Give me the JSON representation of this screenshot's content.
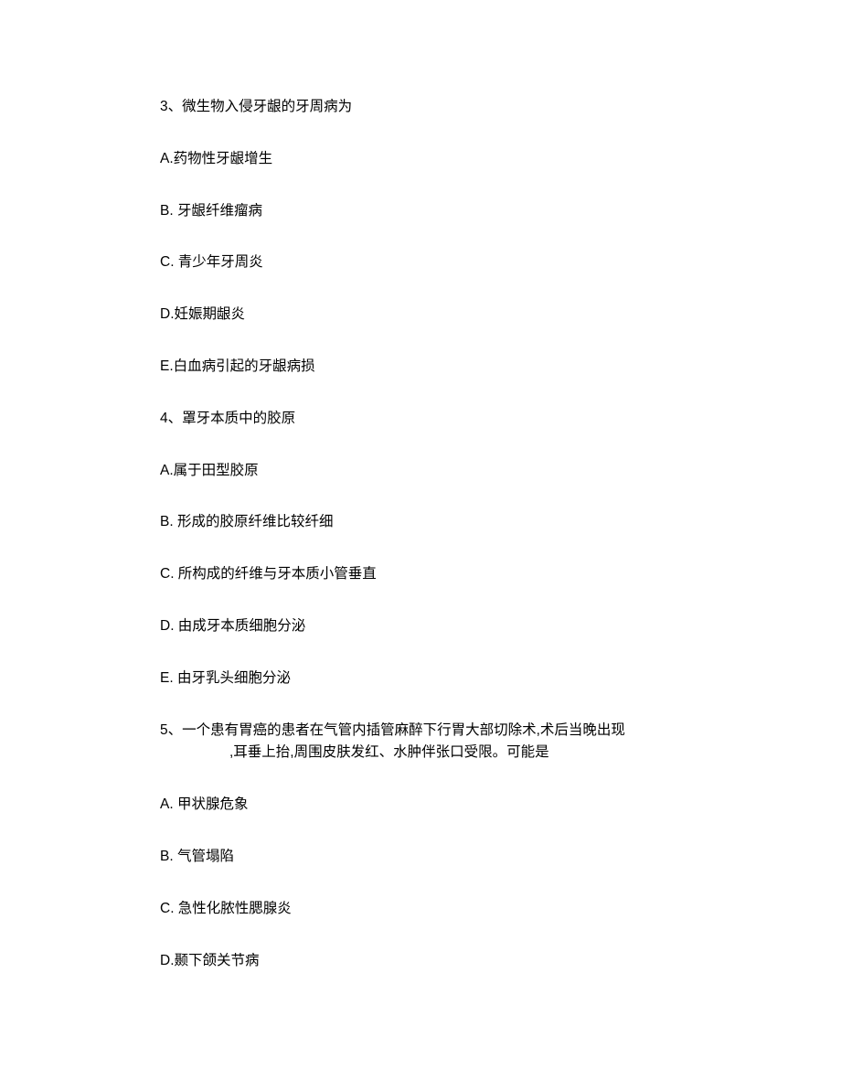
{
  "q3": {
    "stem": "3、微生物入侵牙龈的牙周病为",
    "A": "A.药物性牙龈增生",
    "B": "B. 牙龈纤维瘤病",
    "C": "C. 青少年牙周炎",
    "D": "D.妊娠期龈炎",
    "E": "E.白血病引起的牙龈病损"
  },
  "q4": {
    "stem": "4、罩牙本质中的胶原",
    "A": "A.属于田型胶原",
    "B": "B. 形成的胶原纤维比较纤细",
    "C": "C. 所构成的纤维与牙本质小管垂直",
    "D": "D. 由成牙本质细胞分泌",
    "E": "E. 由牙乳头细胞分泌"
  },
  "q5": {
    "stem_line1": "5、一个患有胃癌的患者在气管内插管麻醉下行胃大部切除术,术后当晚出现",
    "stem_line2": ",耳垂上抬,周围皮肤发红、水肿伴张口受限。可能是",
    "A": "A. 甲状腺危象",
    "B": "B. 气管塌陷",
    "C": "C. 急性化脓性腮腺炎",
    "D": "D.颞下颌关节病"
  }
}
